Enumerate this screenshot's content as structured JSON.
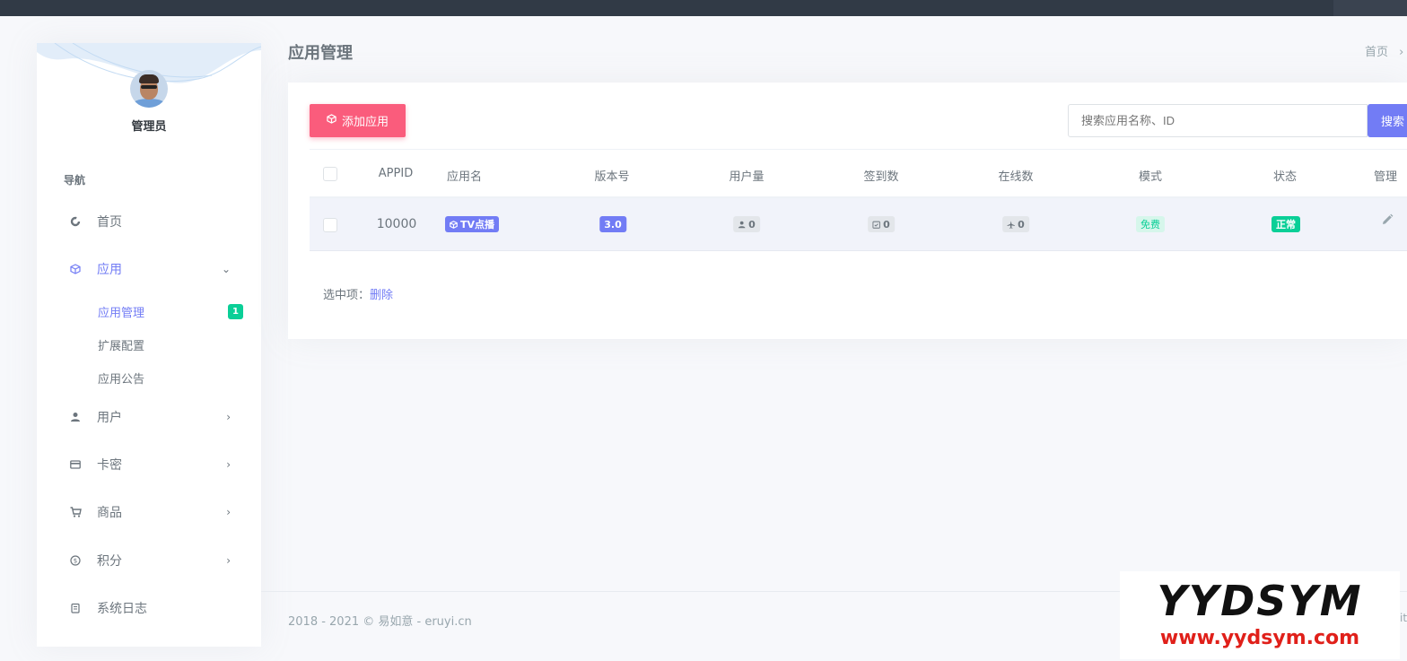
{
  "user": {
    "name": "管理员"
  },
  "nav": {
    "title": "导航",
    "items": [
      {
        "label": "首页",
        "icon": "dashboard-icon"
      },
      {
        "label": "应用",
        "icon": "cube-icon",
        "expanded": true
      },
      {
        "label": "用户",
        "icon": "user-icon"
      },
      {
        "label": "卡密",
        "icon": "card-icon"
      },
      {
        "label": "商品",
        "icon": "cart-icon"
      },
      {
        "label": "积分",
        "icon": "coin-icon"
      },
      {
        "label": "系统日志",
        "icon": "log-icon"
      }
    ],
    "sub_items": [
      {
        "label": "应用管理",
        "badge": "1"
      },
      {
        "label": "扩展配置"
      },
      {
        "label": "应用公告"
      }
    ]
  },
  "header": {
    "title": "应用管理",
    "breadcrumb_home": "首页",
    "breadcrumb_sep": "›"
  },
  "toolbar": {
    "add_label": "添加应用",
    "search_placeholder": "搜索应用名称、ID",
    "search_button": "搜索"
  },
  "table": {
    "headers": [
      "APPID",
      "应用名",
      "版本号",
      "用户量",
      "签到数",
      "在线数",
      "模式",
      "状态",
      "管理"
    ],
    "rows": [
      {
        "appid": "10000",
        "name": "TV点播",
        "version": "3.0",
        "users": "0",
        "signins": "0",
        "online": "0",
        "mode": "免费",
        "status": "正常"
      }
    ]
  },
  "selected_ops": {
    "label": "选中项：",
    "delete": "删除"
  },
  "footer": {
    "text": "2018 - 2021 © 易如意 - eruyi.cn"
  },
  "watermark": {
    "big": "YYDSYM",
    "small": "www.yydsym.com",
    "edge": "it"
  },
  "colors": {
    "primary": "#727cf5",
    "danger": "#fa5c7c",
    "success": "#0acf97",
    "topbar": "#313a46"
  }
}
